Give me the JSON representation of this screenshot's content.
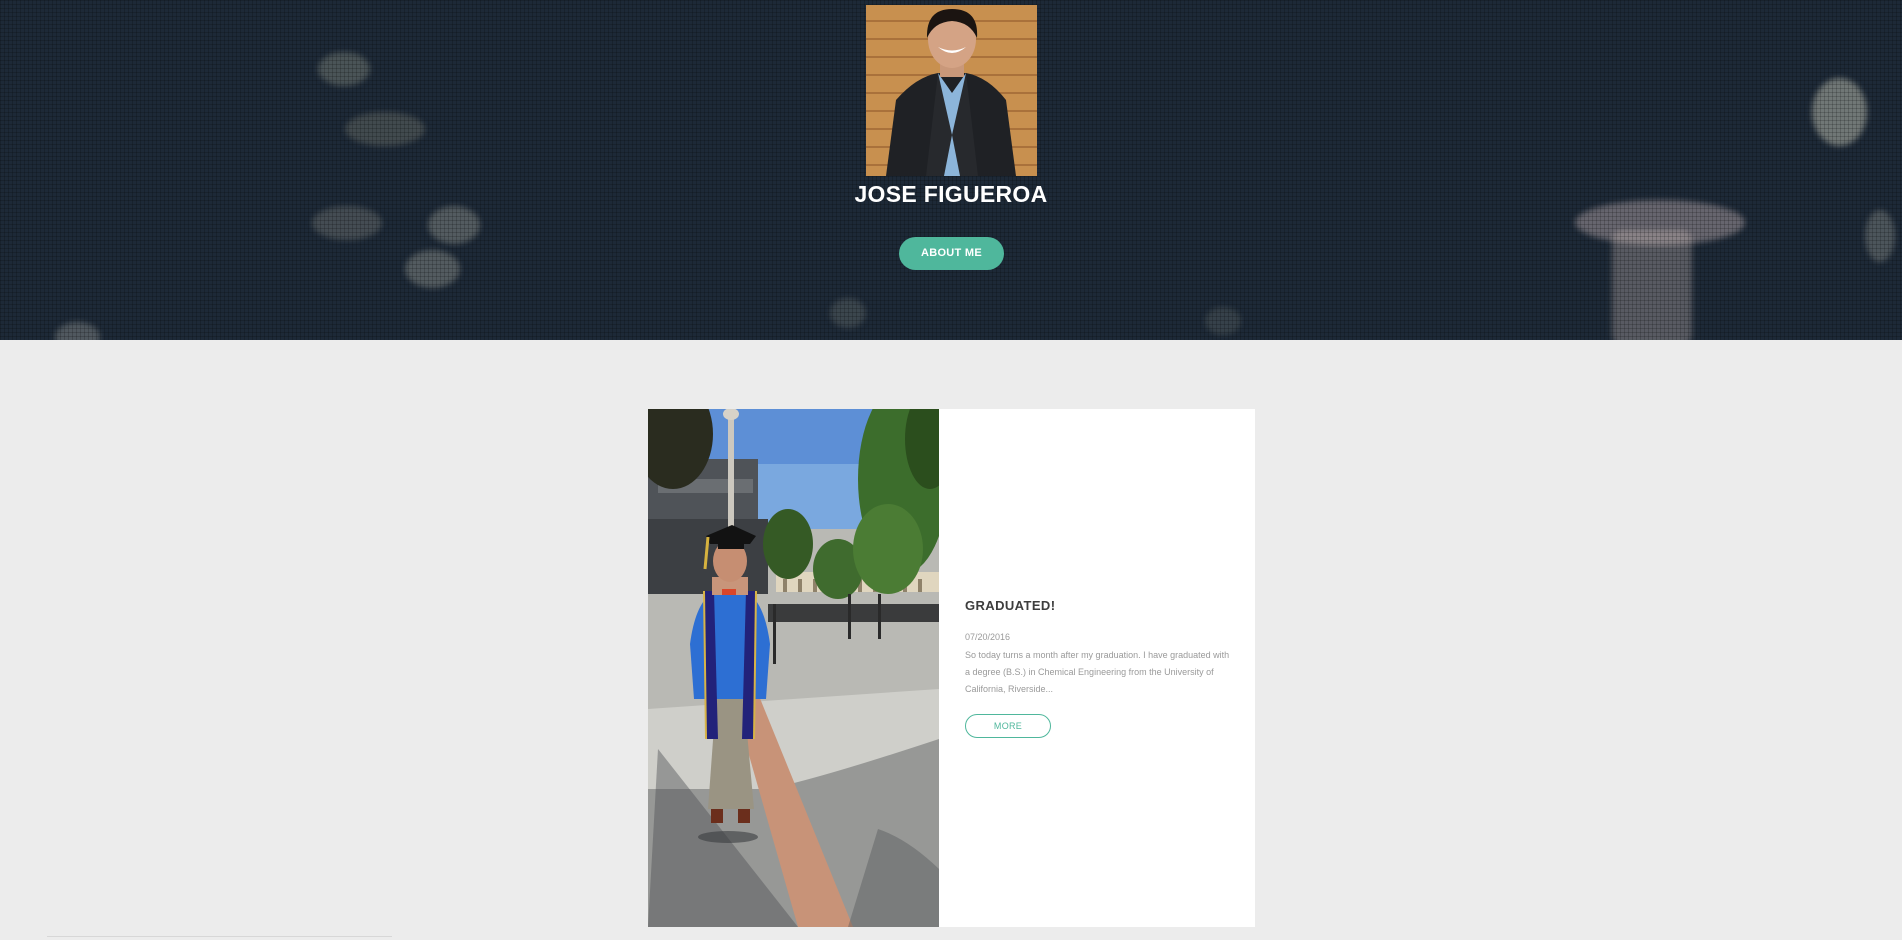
{
  "hero": {
    "name": "JOSE FIGUEROA",
    "about_label": "ABOUT ME"
  },
  "post": {
    "title": "GRADUATED!",
    "date": "07/20/2016",
    "excerpt": "So today turns a month after my graduation. I have graduated with a degree (B.S.) in Chemical Engineering from the University of California, Riverside...",
    "more_label": "MORE"
  },
  "colors": {
    "hero_bg": "#1d2937",
    "accent": "#4fb79c",
    "page_bg": "#ececec"
  }
}
